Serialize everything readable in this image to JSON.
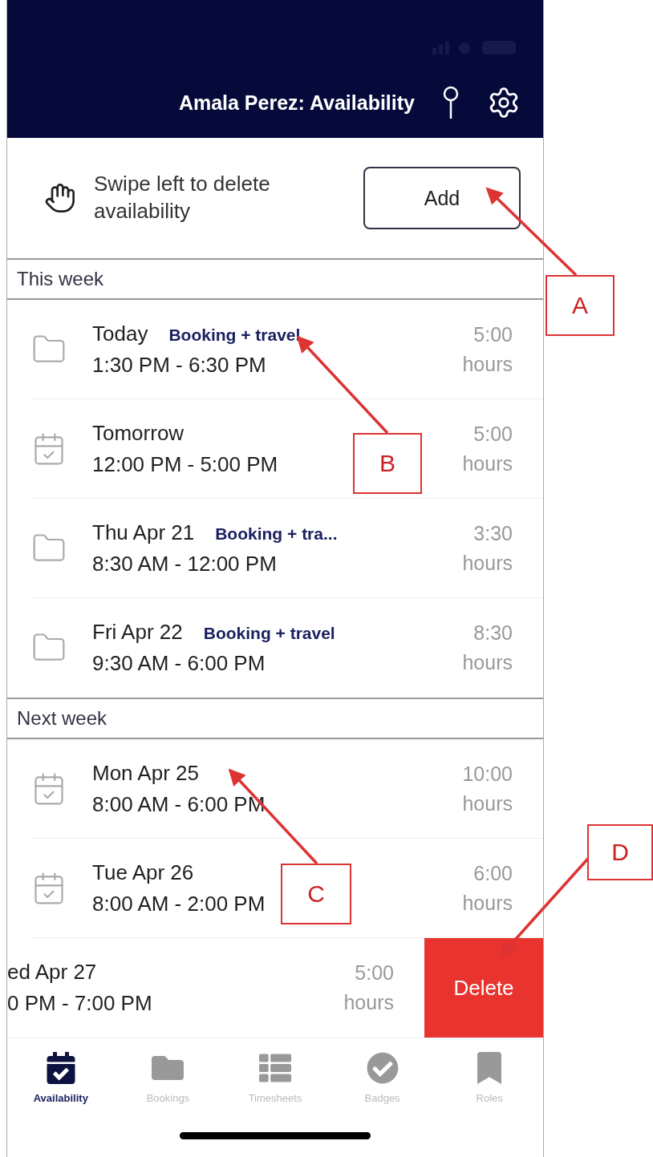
{
  "header": {
    "title": "Amala Perez: Availability"
  },
  "hint": {
    "text": "Swipe left to delete availability",
    "add_button": "Add"
  },
  "sections": [
    {
      "title": "This week",
      "rows": [
        {
          "kind": "folder",
          "day": "Today",
          "tag": "Booking + travel",
          "time": "1:30 PM - 6:30 PM",
          "duration": "5:00",
          "unit": "hours"
        },
        {
          "kind": "calendar",
          "day": "Tomorrow",
          "time": "12:00 PM - 5:00 PM",
          "duration": "5:00",
          "unit": "hours"
        },
        {
          "kind": "folder",
          "day": "Thu Apr 21",
          "tag": "Booking + tra...",
          "time": "8:30 AM - 12:00 PM",
          "duration": "3:30",
          "unit": "hours"
        },
        {
          "kind": "folder",
          "day": "Fri Apr 22",
          "tag": "Booking + travel",
          "time": "9:30 AM - 6:00 PM",
          "duration": "8:30",
          "unit": "hours"
        }
      ]
    },
    {
      "title": "Next week",
      "rows": [
        {
          "kind": "calendar",
          "day": "Mon Apr 25",
          "time": "8:00 AM - 6:00 PM",
          "duration": "10:00",
          "unit": "hours"
        },
        {
          "kind": "calendar",
          "day": "Tue Apr 26",
          "time": "8:00 AM - 2:00 PM",
          "duration": "6:00",
          "unit": "hours"
        },
        {
          "kind": "swiped",
          "day": "ed Apr 27",
          "time": "0 PM - 7:00 PM",
          "duration": "5:00",
          "unit": "hours",
          "delete_label": "Delete"
        }
      ]
    }
  ],
  "tabs": [
    {
      "label": "Availability",
      "selected": true
    },
    {
      "label": "Bookings",
      "selected": false
    },
    {
      "label": "Timesheets",
      "selected": false
    },
    {
      "label": "Badges",
      "selected": false
    },
    {
      "label": "Roles",
      "selected": false
    }
  ],
  "annotations": [
    {
      "label": "A"
    },
    {
      "label": "B"
    },
    {
      "label": "C"
    },
    {
      "label": "D"
    }
  ]
}
